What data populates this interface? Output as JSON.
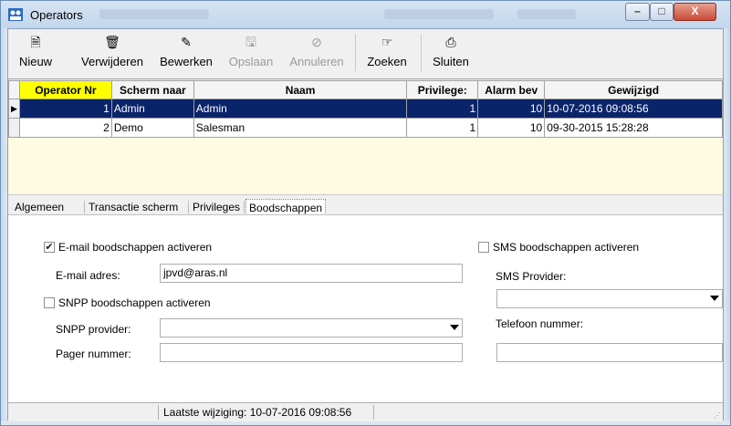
{
  "window": {
    "title": "Operators",
    "controls": {
      "minimize": "–",
      "maximize": "□",
      "close": "X"
    }
  },
  "toolbar": {
    "new": "Nieuw",
    "delete": "Verwijderen",
    "edit": "Bewerken",
    "save": "Opslaan",
    "cancel": "Annuleren",
    "search": "Zoeken",
    "close": "Sluiten"
  },
  "grid": {
    "columns": [
      "Operator Nr",
      "Scherm naar",
      "Naam",
      "Privilege:",
      "Alarm bev",
      "Gewijzigd"
    ],
    "rows": [
      {
        "nr": "1",
        "screen": "Admin",
        "name": "Admin",
        "privilege": "1",
        "alarm": "10",
        "modified": "10-07-2016 09:08:56"
      },
      {
        "nr": "2",
        "screen": "Demo",
        "name": "Salesman",
        "privilege": "1",
        "alarm": "10",
        "modified": "09-30-2015 15:28:28"
      }
    ],
    "row_indicator": "▶"
  },
  "tabs": [
    "Algemeen",
    "Transactie scherm",
    "Privileges",
    "Boodschappen"
  ],
  "messages": {
    "email_enable": "E-mail boodschappen activeren",
    "email_enabled_mark": "✔",
    "email_label": "E-mail adres:",
    "email_value": "jpvd@aras.nl",
    "snpp_enable": "SNPP boodschappen activeren",
    "snpp_provider_label": "SNPP provider:",
    "pager_label": "Pager nummer:",
    "sms_enable": "SMS boodschappen activeren",
    "sms_provider_label": "SMS Provider:",
    "phone_label": "Telefoon nummer:"
  },
  "status": {
    "last_change": "Laatste wijziging: 10-07-2016 09:08:56"
  }
}
